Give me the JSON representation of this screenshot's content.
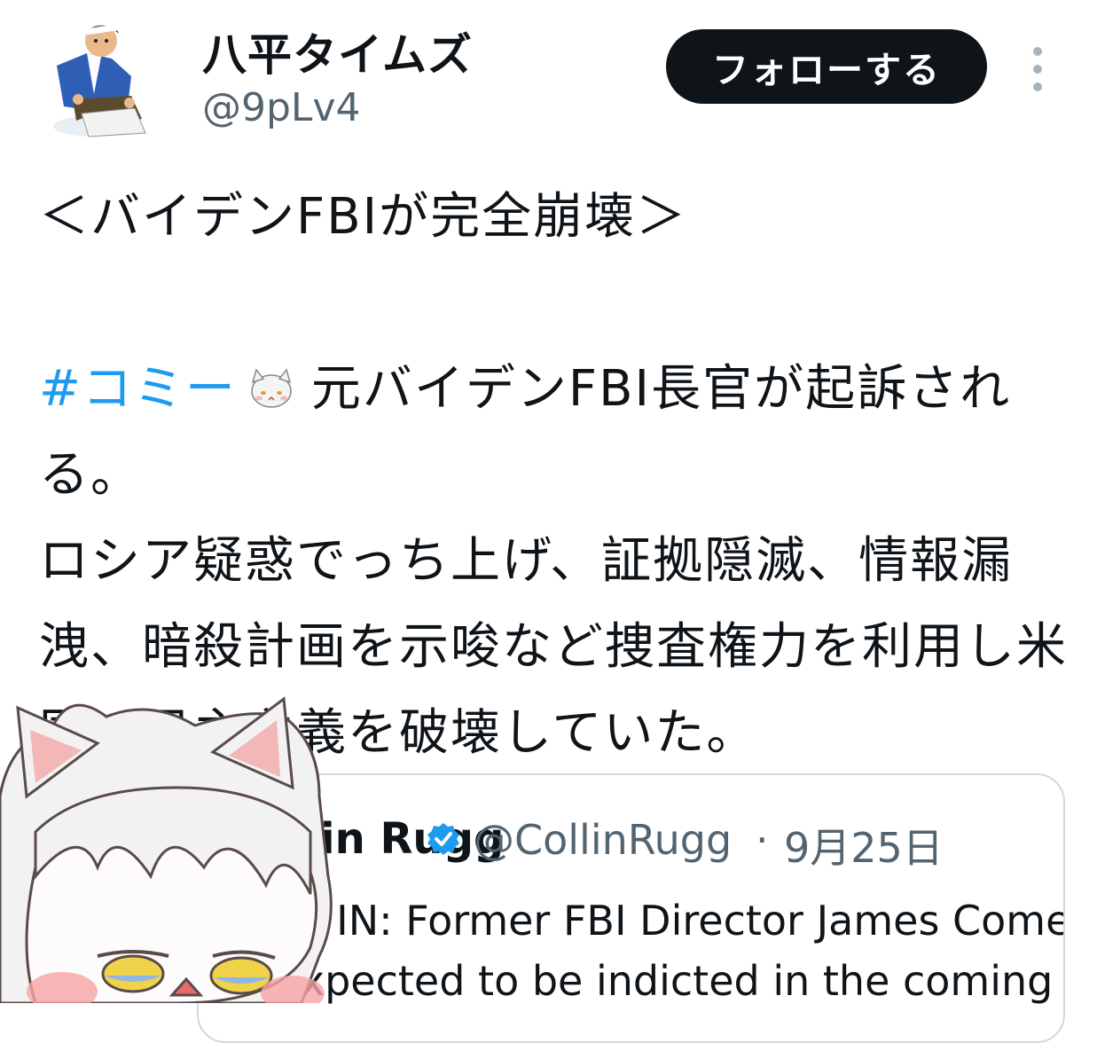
{
  "author": {
    "display_name": "八平タイムズ",
    "handle": "@9pLv4"
  },
  "actions": {
    "follow_label": "フォローする",
    "more_icon": "more-vertical-icon"
  },
  "tweet": {
    "title": "＜バイデンFBIが完全崩壊＞",
    "hashtag": "#コミー",
    "inline_emoji": "anime-girl-emoji",
    "text_after_hashtag": "元バイデンFBI長官が起訴される。",
    "body": "ロシア疑惑でっち上げ、証拠隠滅、情報漏洩、暗殺計画を示唆など捜査権力を利用し米国の民主主義を破壊していた。"
  },
  "quote": {
    "author_name": "Collin Rugg",
    "verified_icon": "verified-badge-icon",
    "handle": "@CollinRugg",
    "separator": "·",
    "date": "9月25日",
    "text_line1": "JUST IN: Former FBI Director James Comey",
    "text_line2": "is expected to be indicted in the coming"
  },
  "overlay": {
    "sticker": "anime-girl-sticker"
  },
  "colors": {
    "text": "#0f1419",
    "secondary": "#536471",
    "link": "#1d9bf0",
    "button_bg": "#0f1419",
    "border": "#cfd9de",
    "verified": "#1d9bf0"
  }
}
